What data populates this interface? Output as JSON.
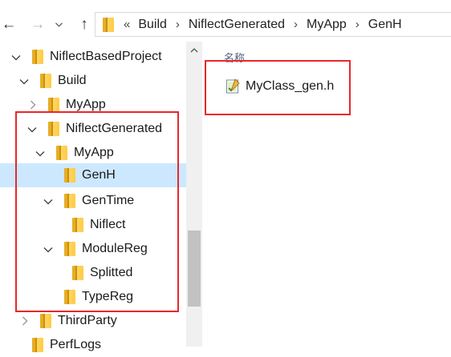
{
  "nav": {
    "back_icon": "arrow-left-icon",
    "forward_icon": "arrow-right-icon",
    "dropdown_icon": "chevron-down-icon",
    "up_icon": "arrow-up-icon"
  },
  "address": {
    "overflow": "«",
    "separator": "›",
    "crumbs": [
      "Build",
      "NiflectGenerated",
      "MyApp",
      "GenH"
    ]
  },
  "tree": {
    "items": [
      {
        "label": "NiflectBasedProject",
        "expanded": true
      },
      {
        "label": "Build",
        "expanded": true
      },
      {
        "label": "MyApp",
        "expanded": false
      },
      {
        "label": "NiflectGenerated",
        "expanded": true
      },
      {
        "label": "MyApp",
        "expanded": true
      },
      {
        "label": "GenH",
        "expanded": false,
        "selected": true
      },
      {
        "label": "GenTime",
        "expanded": true
      },
      {
        "label": "Niflect",
        "expanded": false
      },
      {
        "label": "ModuleReg",
        "expanded": true
      },
      {
        "label": "Splitted",
        "expanded": false
      },
      {
        "label": "TypeReg",
        "expanded": false
      },
      {
        "label": "ThirdParty",
        "expanded": false
      },
      {
        "label": "PerfLogs",
        "expanded": false
      }
    ]
  },
  "content": {
    "column_name": "名称",
    "files": [
      {
        "name": "MyClass_gen.h",
        "icon": "h-file-icon"
      }
    ]
  },
  "colors": {
    "selection": "#cce8ff",
    "highlight": "#e8272c",
    "folder": "#ffcb45"
  }
}
